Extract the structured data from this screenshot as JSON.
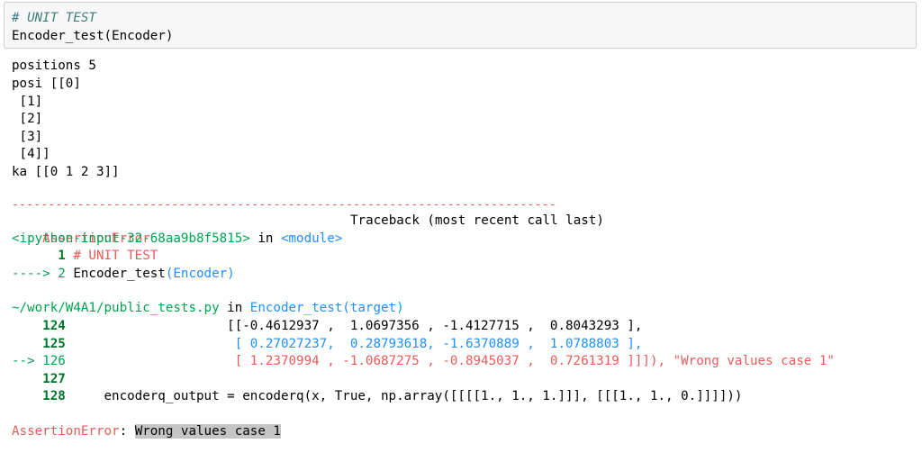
{
  "code_cell": {
    "comment": "# UNIT TEST",
    "code": "Encoder_test(Encoder)"
  },
  "stdout": [
    "positions 5",
    "posi [[0]",
    " [1]",
    " [2]",
    " [3]",
    " [4]]",
    "ka [[0 1 2 3]]"
  ],
  "traceback": {
    "separator": "---------------------------------------------------------------------------",
    "error_name": "AssertionError",
    "traceback_header": "Traceback (most recent call last)",
    "input_ref": "<ipython-input-32-68aa9b8f5815>",
    "in_word": " in ",
    "module": "<module>",
    "frame1": {
      "line1_num": "      1",
      "line1_code": " # UNIT TEST",
      "arrow": "----> 2",
      "line2_func": " Encoder_test",
      "line2_args": "(Encoder)"
    },
    "frame2": {
      "file": "~/work/W4A1/public_tests.py",
      "in_word": " in ",
      "func": "Encoder_test",
      "args": "(target)",
      "lines": [
        {
          "num": "    124",
          "text": "                     [[-0.4612937 ,  1.0697356 , -1.4127715 ,  0.8043293 ],"
        },
        {
          "num": "    125",
          "text": "                      [ 0.27027237,  0.28793618, -1.6370889 ,  1.0788803 ],"
        },
        {
          "num": "--> 126",
          "text": "                      [ 1.2370994 , -1.0687275 , -0.8945037 ,  0.7261319 ]]]), \"Wrong values case 1\""
        },
        {
          "num": "    127",
          "text": ""
        },
        {
          "num": "    128",
          "text": "     encoderq_output = encoderq(x, True, np.array([[[[1., 1., 1.]]], [[[1., 1., 0.]]]]))"
        }
      ]
    },
    "final_error_name": "AssertionError",
    "final_sep": ": ",
    "final_message": "Wrong values case 1"
  }
}
